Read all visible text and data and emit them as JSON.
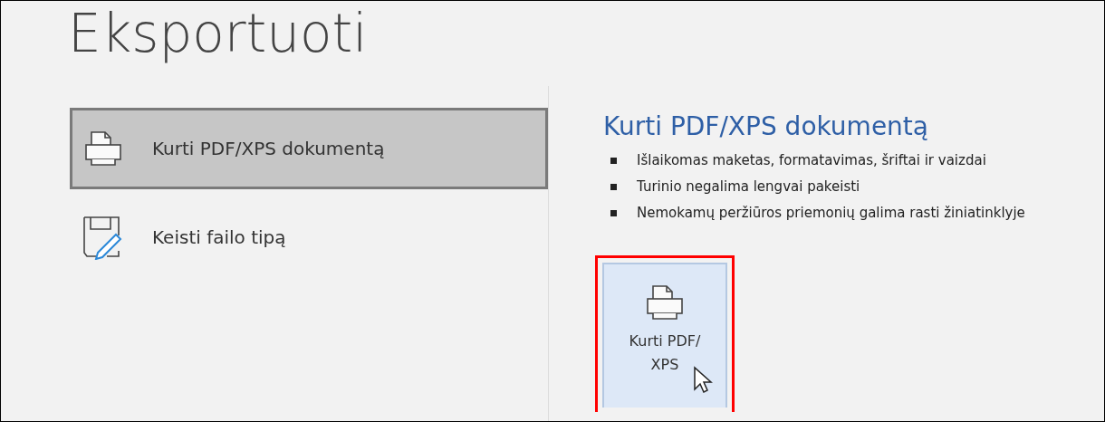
{
  "title": "Eksportuoti",
  "nav_items": [
    {
      "label": "Kurti PDF/XPS dokumentą",
      "kind": "pdf",
      "selected": true
    },
    {
      "label": "Keisti failo tipą",
      "kind": "filetype",
      "selected": false
    }
  ],
  "detail": {
    "heading": "Kurti PDF/XPS dokumentą",
    "bullets": [
      "Išlaikomas maketas, formatavimas, šriftai ir vaizdai",
      "Turinio negalima lengvai pakeisti",
      "Nemokamų peržiūros priemonių galima rasti žiniatinklyje"
    ],
    "button": {
      "label_lines": [
        "Kurti PDF/",
        "XPS"
      ],
      "highlighted": true
    }
  }
}
